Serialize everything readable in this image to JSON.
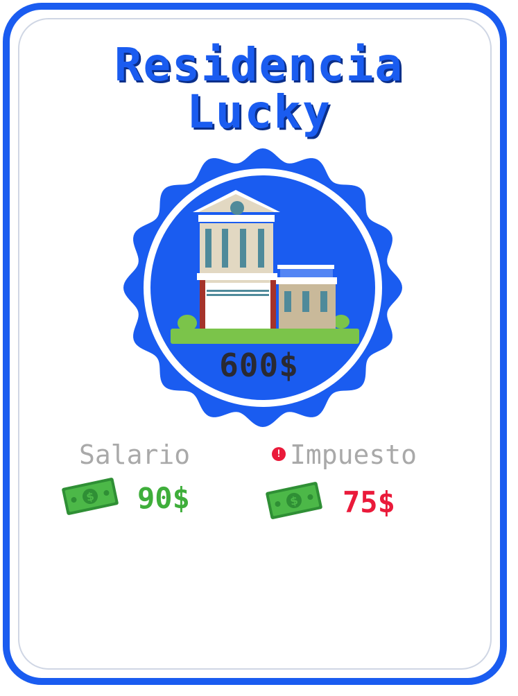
{
  "card": {
    "title_line1": "Residencia",
    "title_line2": "Lucky",
    "price": "600$",
    "salary": {
      "label": "Salario",
      "amount": "90$"
    },
    "tax": {
      "label": "Impuesto",
      "amount": "75$"
    }
  },
  "icons": {
    "building": "house-building-icon",
    "money": "cash-bill-icon",
    "info": "info-dot-icon"
  },
  "colors": {
    "brand_blue": "#1a5cf0",
    "salary_green": "#3fae3b",
    "tax_red": "#ea1a3a",
    "label_gray": "#a9a9a9",
    "price_dark": "#2a2a33"
  }
}
